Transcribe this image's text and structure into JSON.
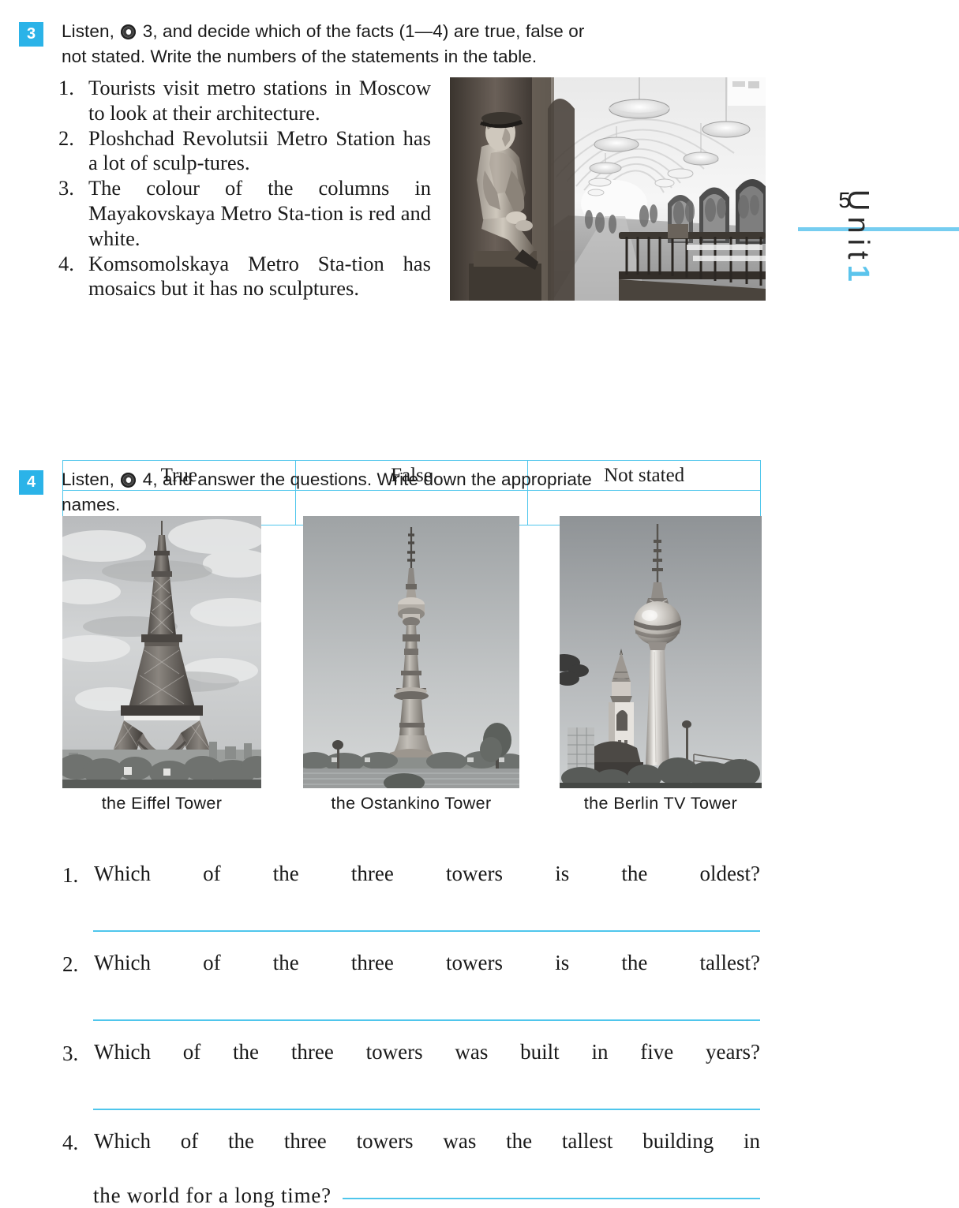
{
  "page": {
    "number": "5",
    "unit_word": "Unit",
    "unit_number": "1",
    "accent_color": "#2BB3E8",
    "rule_color": "#4FC6EC"
  },
  "exercise3": {
    "number": "3",
    "instruction_part1": "Listen,",
    "audio_icon": "cd-icon",
    "instruction_part2": "3, and decide which of the facts (1—4) are true, false or",
    "instruction_line2": "not stated. Write the numbers of the statements in the table.",
    "facts": [
      {
        "num": "1.",
        "text": "Tourists visit metro stations in Moscow to look at their architecture."
      },
      {
        "num": "2.",
        "text": "Ploshchad Revolutsii Metro Station has a lot of sculp-tures."
      },
      {
        "num": "3.",
        "text": "The colour of the columns in Mayakovskaya Metro Sta-tion is red and white."
      },
      {
        "num": "4.",
        "text": "Komsomolskaya Metro Sta-tion has mosaics but it has no sculptures."
      }
    ],
    "photo_caption": "Ploshchad Revolutsii Metro Station interior with bronze sculpture",
    "table": {
      "headers": [
        "True",
        "False",
        "Not stated"
      ],
      "answers": [
        "",
        "",
        ""
      ]
    }
  },
  "exercise4": {
    "number": "4",
    "instruction_part1": "Listen,",
    "audio_icon": "cd-icon",
    "instruction_part2": "4, and answer the questions. Write down the appropriate",
    "instruction_line2": "names.",
    "towers": [
      {
        "caption": "the  Eiffel  Tower",
        "image_name": "eiffel-tower-photo"
      },
      {
        "caption": "the  Ostankino  Tower",
        "image_name": "ostankino-tower-photo"
      },
      {
        "caption": "the  Berlin  TV  Tower",
        "image_name": "berlin-tv-tower-photo"
      }
    ],
    "questions": [
      {
        "num": "1.",
        "text": "Which of the three towers is the oldest?",
        "answer": ""
      },
      {
        "num": "2.",
        "text": "Which of the three towers is the tallest?",
        "answer": ""
      },
      {
        "num": "3.",
        "text": "Which of the three towers was built in five years?",
        "answer": ""
      },
      {
        "num": "4.",
        "text": "Which of the three towers was the tallest building in",
        "text_line2": "the  world  for  a  long  time?",
        "answer": ""
      }
    ]
  }
}
